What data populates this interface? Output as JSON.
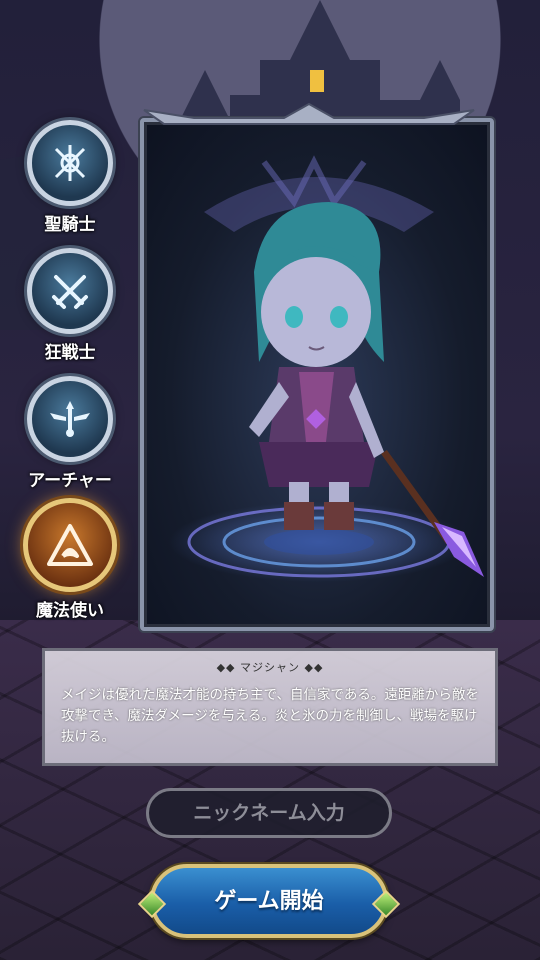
{
  "classes": [
    {
      "label": "聖騎士",
      "icon": "paladin-emblem-icon",
      "active": false
    },
    {
      "label": "狂戦士",
      "icon": "crossed-swords-icon",
      "active": false
    },
    {
      "label": "アーチャー",
      "icon": "winged-arrow-icon",
      "active": false
    },
    {
      "label": "魔法使い",
      "icon": "triangle-rune-icon",
      "active": true
    }
  ],
  "description": {
    "title": "マジシャン",
    "text": "メイジは優れた魔法才能の持ち主で、自信家である。遠距離から敵を攻撃でき、魔法ダメージを与える。炎と氷の力を制御し、戦場を駆け抜ける。"
  },
  "nickname": {
    "placeholder": "ニックネーム入力"
  },
  "start_button": {
    "label": "ゲーム開始"
  },
  "colors": {
    "accent_gold": "#d9c27a",
    "start_blue": "#1a5ea8",
    "active_orange": "#c8782c"
  }
}
